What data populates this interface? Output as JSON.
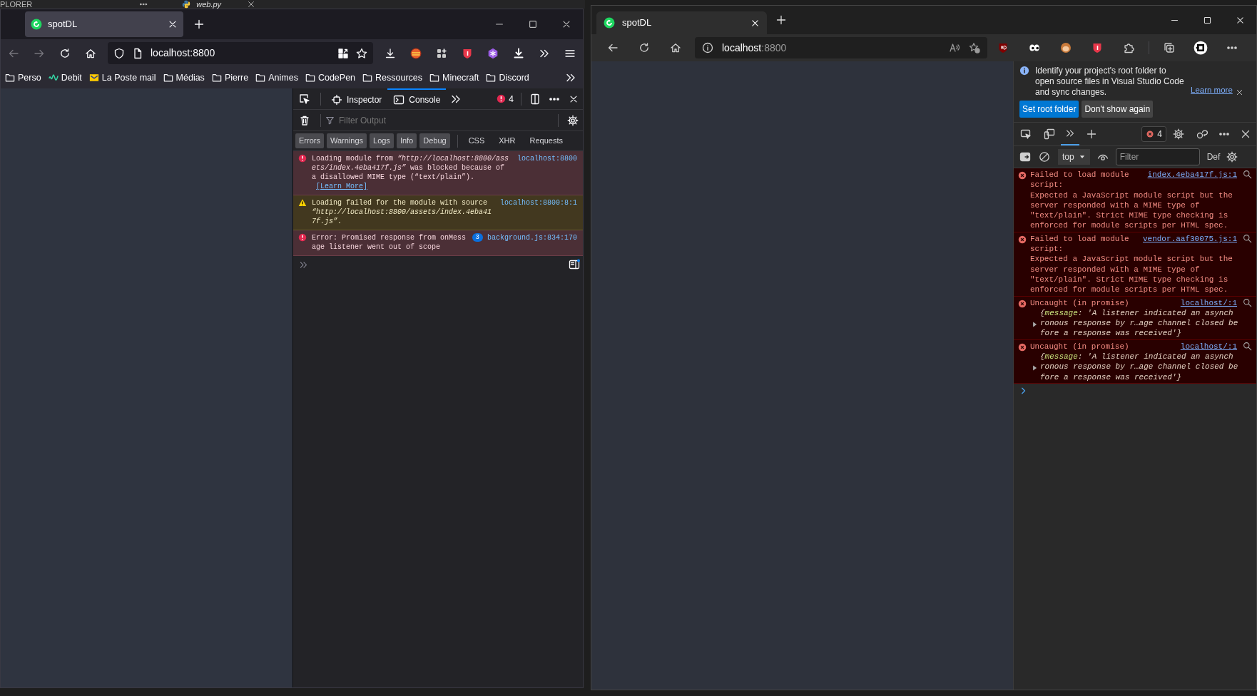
{
  "background": {
    "explorer_title": "PLORER",
    "editor_tab": "web.py"
  },
  "firefox": {
    "tabs": [
      {
        "title": "spotDL",
        "selected": true
      }
    ],
    "url": "localhost:8800",
    "bookmarks": [
      {
        "label": "Perso",
        "kind": "folder"
      },
      {
        "label": "Debit",
        "kind": "wave"
      },
      {
        "label": "La Poste mail",
        "kind": "mail"
      },
      {
        "label": "Médias",
        "kind": "folder"
      },
      {
        "label": "Pierre",
        "kind": "folder"
      },
      {
        "label": "Animes",
        "kind": "folder"
      },
      {
        "label": "CodePen",
        "kind": "folder"
      },
      {
        "label": "Ressources",
        "kind": "folder"
      },
      {
        "label": "Minecraft",
        "kind": "folder"
      },
      {
        "label": "Discord",
        "kind": "folder"
      }
    ],
    "devtools": {
      "tabs": [
        {
          "label": "Inspector",
          "kind": "inspector",
          "selected": false
        },
        {
          "label": "Console",
          "kind": "console",
          "selected": true
        }
      ],
      "error_count": "4",
      "filter_placeholder": "Filter Output",
      "level_filters": [
        {
          "label": "Errors",
          "on": true
        },
        {
          "label": "Warnings",
          "on": true
        },
        {
          "label": "Logs",
          "on": true
        },
        {
          "label": "Info",
          "on": true
        },
        {
          "label": "Debug",
          "on": true
        }
      ],
      "type_filters": [
        {
          "label": "CSS",
          "on": false
        },
        {
          "label": "XHR",
          "on": false
        },
        {
          "label": "Requests",
          "on": false
        }
      ],
      "messages": [
        {
          "kind": "error",
          "text": "Loading module from *“http://localhost:8800/assets/index.4eba417f.js”* was blocked because of a disallowed MIME type (“text/plain”).",
          "link": "[Learn More]",
          "source": "localhost:8800"
        },
        {
          "kind": "warning",
          "text": "Loading failed for the module with source *“http://localhost:8800/assets/index.4eba417f.js”*.",
          "source": "localhost:8800:8:1"
        },
        {
          "kind": "error",
          "text": "Error: Promised response from onMessage listener went out of scope",
          "repeat": "3",
          "source": "background.js:834:170"
        }
      ]
    }
  },
  "edge": {
    "tabs": [
      {
        "title": "spotDL",
        "selected": true
      }
    ],
    "url_host": "localhost",
    "url_port": ":8800",
    "devtools": {
      "infobar": {
        "text": "Identify your project's root folder to open source files in Visual Studio Code and sync changes.",
        "link": "Learn more",
        "buttons": [
          {
            "label": "Set root folder",
            "kind": "primary"
          },
          {
            "label": "Don't show again",
            "kind": "secondary"
          }
        ]
      },
      "overflow_tab_selected": true,
      "error_count": "4",
      "context": "top",
      "filter_placeholder": "Filter",
      "levels_label": "Def",
      "messages": [
        {
          "kind": "error",
          "title": "Failed to load module script:",
          "detail": "Expected a JavaScript module script but the server responded with a MIME type of \"text/plain\". Strict MIME type checking is enforced for module scripts per HTML spec.",
          "source": "index.4eba417f.js:1"
        },
        {
          "kind": "error",
          "title": "Failed to load module script:",
          "detail": "Expected a JavaScript module script but the server responded with a MIME type of \"text/plain\". Strict MIME type checking is enforced for module scripts per HTML spec.",
          "source": "vendor.aaf30075.js:1"
        },
        {
          "kind": "error",
          "title": "Uncaught (in promise)",
          "object": "{**message**: 'A listener indicated an asynchronous response by r…age channel closed before a response was received'}",
          "expanded": false,
          "source": "localhost/:1"
        },
        {
          "kind": "error",
          "title": "Uncaught (in promise)",
          "object": "{**message**: 'A listener indicated an asynchronous response by r…age channel closed before a response was received'}",
          "expanded": false,
          "source": "localhost/:1"
        }
      ]
    }
  }
}
